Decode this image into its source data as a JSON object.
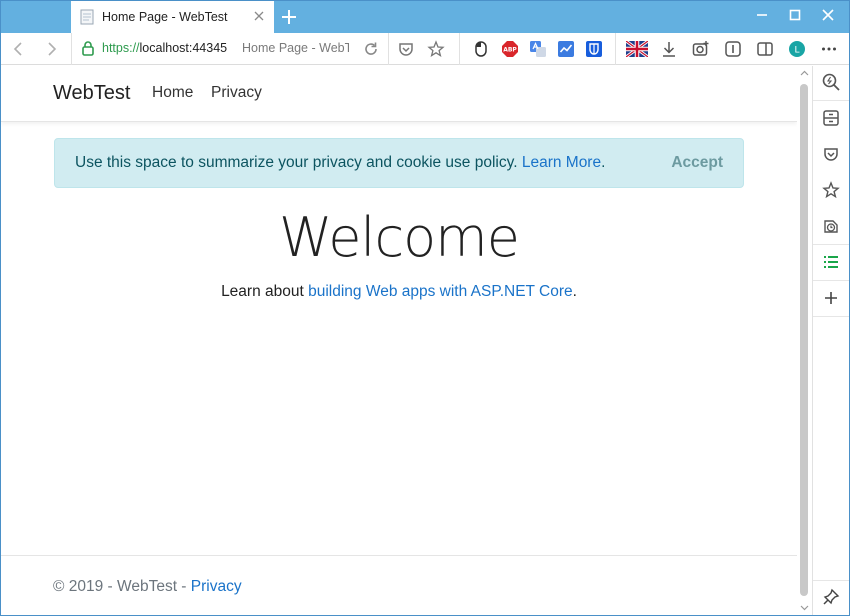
{
  "browser": {
    "tab_title": "Home Page - WebTest",
    "url_scheme": "https://",
    "url_host": "localhost:44345",
    "url_page_title": "Home Page - WebTest",
    "profile_initial": "L",
    "abp_label": "ABP"
  },
  "navbar": {
    "brand": "WebTest",
    "links": [
      "Home",
      "Privacy"
    ]
  },
  "cookie_consent": {
    "message": "Use this space to summarize your privacy and cookie use policy.",
    "link_text": "Learn More",
    "trailing": ".",
    "accept_label": "Accept"
  },
  "main": {
    "heading": "Welcome",
    "lead_prefix": "Learn about ",
    "lead_link": "building Web apps with ASP.NET Core",
    "lead_suffix": "."
  },
  "footer": {
    "text": "© 2019 - WebTest - ",
    "link": "Privacy"
  },
  "colors": {
    "titlebar": "#63b0e0",
    "link": "#1a73c9",
    "alert_bg": "#d1ecf1",
    "alert_text": "#0c5460",
    "secure_green": "#2e9b4e",
    "sidebar_active": "#1aa64a"
  }
}
